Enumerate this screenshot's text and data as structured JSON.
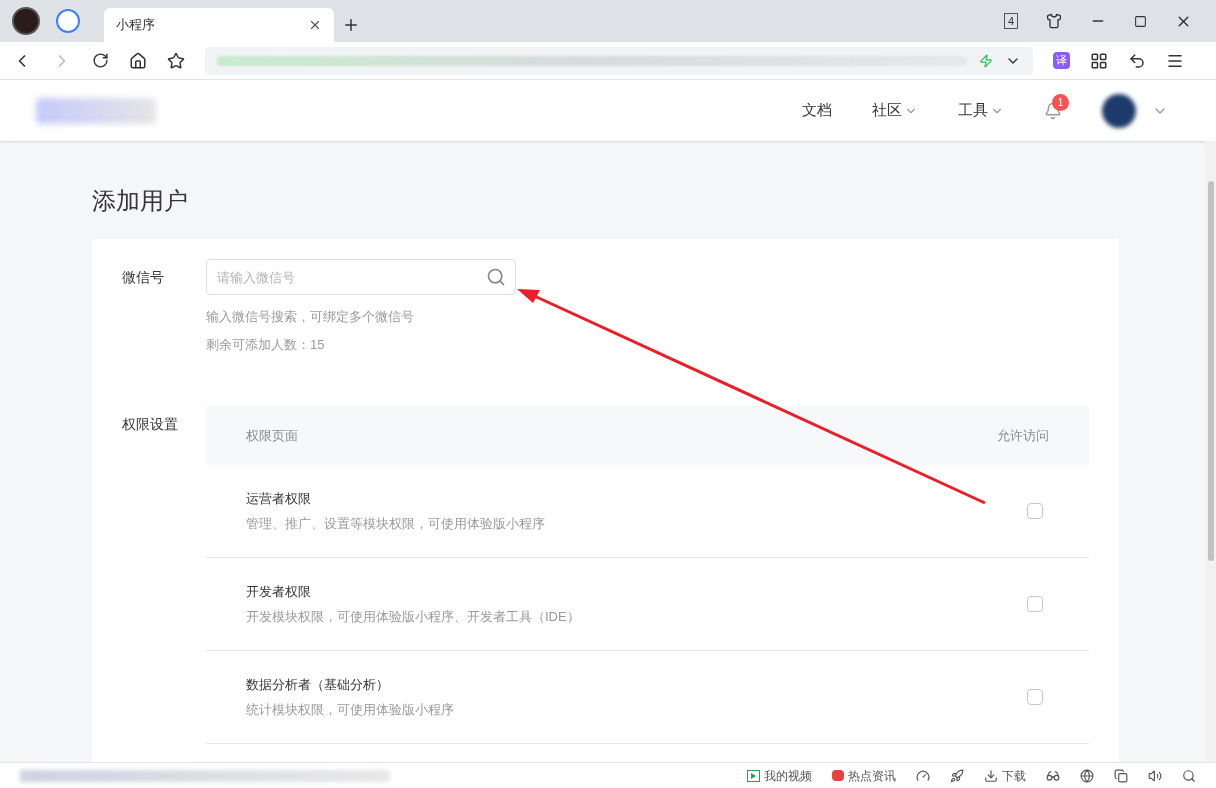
{
  "browser": {
    "tab": {
      "title": "小程序",
      "selected": true
    },
    "tab_count": "4",
    "translate_label": "译"
  },
  "site_nav": {
    "items": [
      {
        "label": "文档",
        "dropdown": false
      },
      {
        "label": "社区",
        "dropdown": true
      },
      {
        "label": "工具",
        "dropdown": true
      }
    ],
    "notification_count": "1"
  },
  "page": {
    "title": "添加用户",
    "wechat": {
      "label": "微信号",
      "placeholder": "请输入微信号",
      "hint": "输入微信号搜索，可绑定多个微信号",
      "remaining": "剩余可添加人数：15"
    },
    "permissions": {
      "label": "权限设置",
      "columns": [
        "权限页面",
        "允许访问"
      ],
      "rows": [
        {
          "name": "运营者权限",
          "description": "管理、推广、设置等模块权限，可使用体验版小程序",
          "checked": false
        },
        {
          "name": "开发者权限",
          "description": "开发模块权限，可使用体验版小程序、开发者工具（IDE）",
          "checked": false
        },
        {
          "name": "数据分析者（基础分析）",
          "description": "统计模块权限，可使用体验版小程序",
          "checked": false
        }
      ]
    }
  },
  "status_bar": {
    "items": [
      "我的视频",
      "热点资讯",
      "下载"
    ]
  }
}
